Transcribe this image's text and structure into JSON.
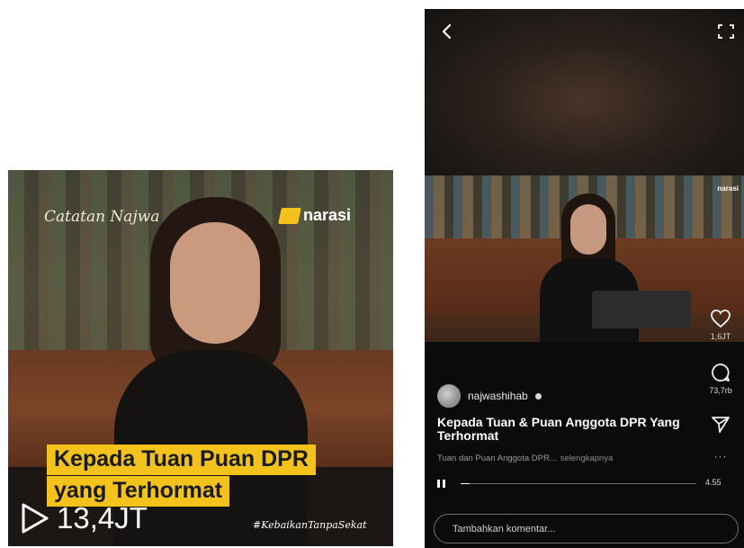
{
  "thumbnail": {
    "script_logo": "Catatan Najwa",
    "brand": "narasi",
    "title_lines": [
      "Kepada Tuan Puan DPR",
      "yang Terhormat"
    ],
    "view_count": "13,4JT",
    "hashtag": "#KebaikanTanpaSekat",
    "colors": {
      "accent": "#f3c21b"
    }
  },
  "reel": {
    "video_brand_tag": "narasi",
    "back_icon": "chevron-left-icon",
    "fullscreen_icon": "fullscreen-icon",
    "actions": {
      "like": {
        "icon": "heart-icon",
        "count": "1,6JT"
      },
      "comment": {
        "icon": "comment-icon",
        "count": "73,7rb"
      },
      "share": {
        "icon": "send-icon"
      },
      "more": {
        "icon": "more-icon",
        "label": "···"
      }
    },
    "author": "najwashihab",
    "title": "Kepada Tuan & Puan Anggota DPR Yang Terhormat",
    "description": "Tuan dan Puan Anggota DPR...",
    "description_more": "selengkapnya",
    "time_remaining": "4.55",
    "progress": 0.04,
    "comment_placeholder": "Tambahkan komentar..."
  }
}
